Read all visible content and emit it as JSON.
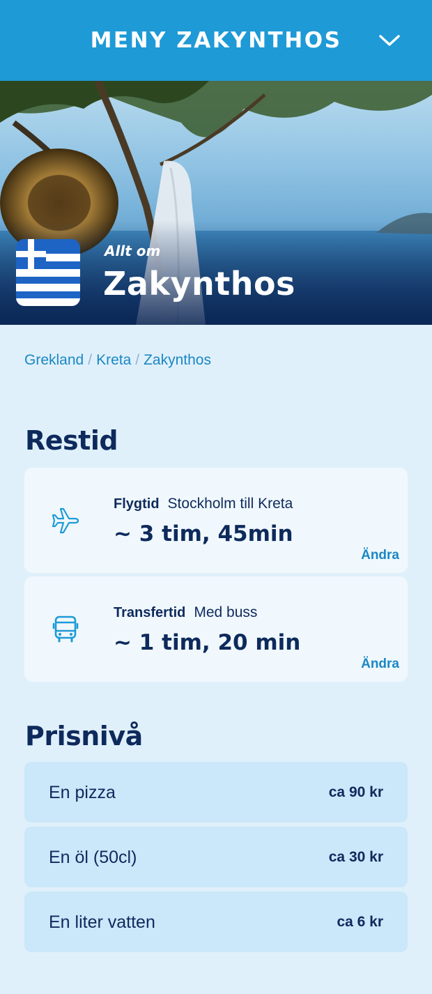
{
  "topbar": {
    "title": "MENY ZAKYNTHOS",
    "chevron_icon": "chevron-down-icon"
  },
  "hero": {
    "subtitle": "Allt om",
    "title": "Zakynthos",
    "flag_icon": "greece-flag-icon"
  },
  "breadcrumb": {
    "items": [
      "Grekland",
      "Kreta",
      "Zakynthos"
    ],
    "separator": "/"
  },
  "restid": {
    "title": "Restid",
    "cards": [
      {
        "icon": "airplane-icon",
        "label": "Flygtid",
        "detail": "Stockholm till Kreta",
        "value": "~ 3 tim, 45min",
        "action": "Ändra"
      },
      {
        "icon": "bus-icon",
        "label": "Transfertid",
        "detail": "Med buss",
        "value": "~ 1 tim, 20 min",
        "action": "Ändra"
      }
    ]
  },
  "prisniva": {
    "title": "Prisnivå",
    "rows": [
      {
        "item": "En pizza",
        "price": "ca 90 kr"
      },
      {
        "item": "En öl (50cl)",
        "price": "ca 30 kr"
      },
      {
        "item": "En liter vatten",
        "price": "ca 6 kr"
      }
    ]
  },
  "colors": {
    "accent": "#1e9ad6",
    "navy": "#0e2a5c",
    "link": "#1a87c4",
    "background": "#e0f0fb"
  }
}
